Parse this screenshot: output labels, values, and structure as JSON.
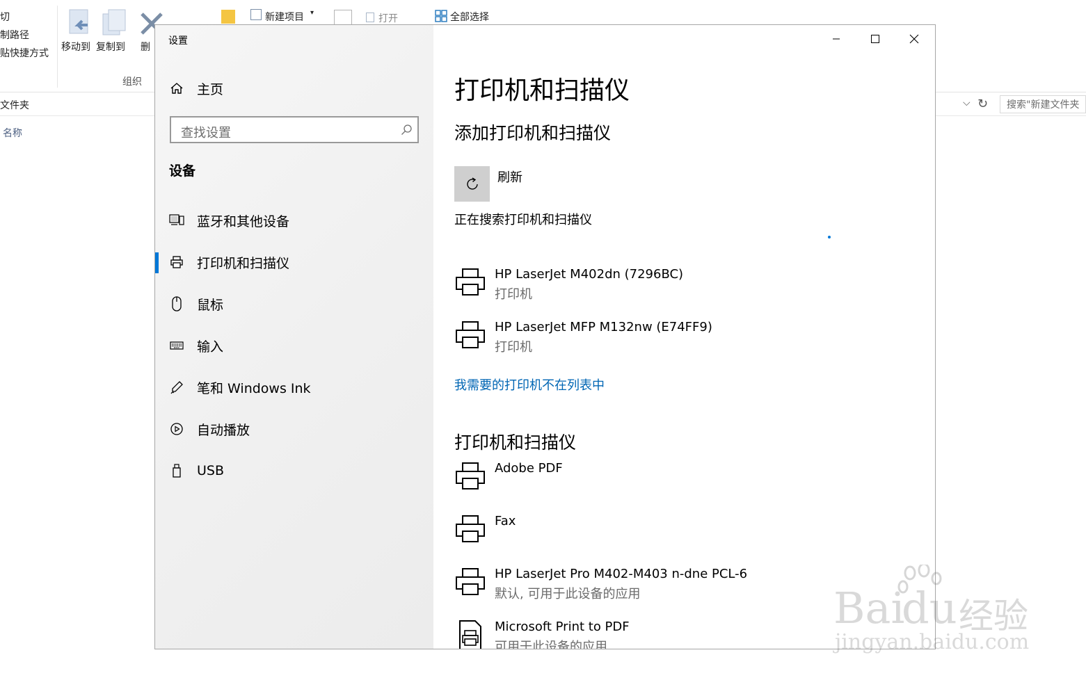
{
  "explorer": {
    "ribbon": {
      "clip_partial": "切",
      "copy_path_partial": "制路径",
      "paste_shortcut_partial": "贴快捷方式",
      "move_to": "移动到",
      "copy_to": "复制到",
      "delete_partial": "删",
      "group_organize": "组织",
      "new_item": "新建项目",
      "open": "打开",
      "select_all": "全部选择"
    },
    "address_partial": "文件夹",
    "search_placeholder": "搜索\"新建文件夹",
    "column_name": "名称"
  },
  "settings": {
    "window_title": "设置",
    "nav": {
      "home": "主页",
      "search_placeholder": "查找设置",
      "section": "设备",
      "items": [
        {
          "label": "蓝牙和其他设备",
          "icon": "bluetooth-devices-icon"
        },
        {
          "label": "打印机和扫描仪",
          "icon": "printer-icon",
          "selected": true
        },
        {
          "label": "鼠标",
          "icon": "mouse-icon"
        },
        {
          "label": "输入",
          "icon": "keyboard-icon"
        },
        {
          "label": "笔和 Windows Ink",
          "icon": "pen-icon"
        },
        {
          "label": "自动播放",
          "icon": "autoplay-icon"
        },
        {
          "label": "USB",
          "icon": "usb-icon"
        }
      ]
    },
    "page_title": "打印机和扫描仪",
    "add_section": {
      "heading": "添加打印机和扫描仪",
      "refresh_label": "刷新",
      "searching_text": "正在搜索打印机和扫描仪",
      "found": [
        {
          "name": "HP LaserJet M402dn (7296BC)",
          "type": "打印机"
        },
        {
          "name": "HP LaserJet MFP M132nw (E74FF9)",
          "type": "打印机"
        }
      ],
      "not_listed_link": "我需要的打印机不在列表中"
    },
    "installed_section": {
      "heading": "打印机和扫描仪",
      "devices": [
        {
          "name": "Adobe PDF",
          "sub": ""
        },
        {
          "name": "Fax",
          "sub": ""
        },
        {
          "name": "HP LaserJet Pro M402-M403 n-dne PCL-6",
          "sub": "默认, 可用于此设备的应用"
        },
        {
          "name": "Microsoft Print to PDF",
          "sub": "可用于此设备的应用"
        }
      ]
    },
    "accent_color": "#0078d7",
    "link_color": "#0066b4"
  },
  "watermark": {
    "brand": "Bai",
    "brand2": "du",
    "brand_cn": "经验",
    "url": "jingyan.baidu.com"
  }
}
